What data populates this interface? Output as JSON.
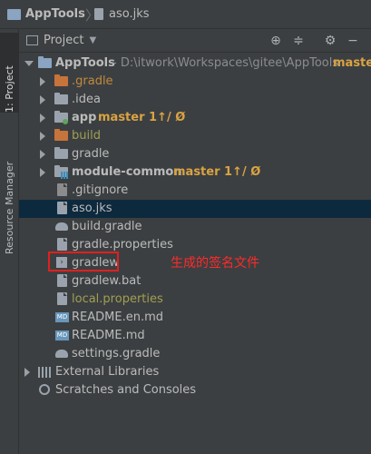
{
  "titlebar": {
    "project": "AppTools",
    "file": "aso.jks"
  },
  "left_tabs": {
    "project": "1: Project",
    "resource_manager": "Resource Manager"
  },
  "panel": {
    "title": "Project"
  },
  "tree": {
    "root": {
      "name": "AppTools",
      "path": " - D:\\itwork\\Workspaces\\gitee\\AppTools",
      "branch": "maste"
    },
    "items": [
      {
        "name": ".gradle"
      },
      {
        "name": ".idea"
      },
      {
        "name": "app",
        "branch": "master 1↑/ Ø"
      },
      {
        "name": "build"
      },
      {
        "name": "gradle"
      },
      {
        "name": "module-common",
        "branch": "master 1↑/ Ø"
      },
      {
        "name": ".gitignore"
      },
      {
        "name": "aso.jks"
      },
      {
        "name": "build.gradle"
      },
      {
        "name": "gradle.properties"
      },
      {
        "name": "gradlew"
      },
      {
        "name": "gradlew.bat"
      },
      {
        "name": "local.properties"
      },
      {
        "name": "README.en.md"
      },
      {
        "name": "README.md"
      },
      {
        "name": "settings.gradle"
      }
    ],
    "external": "External Libraries",
    "scratches": "Scratches and Consoles"
  },
  "annotation": "生成的签名文件",
  "colors": {
    "accent": "#0d293e",
    "annotation": "#e02020",
    "git": "#d9a343"
  }
}
